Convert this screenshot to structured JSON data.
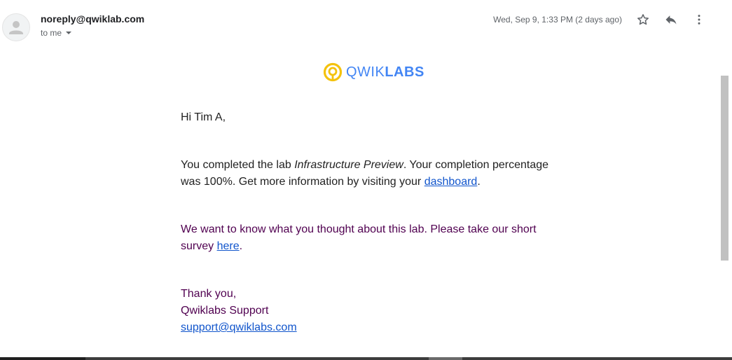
{
  "header": {
    "sender": "noreply@qwiklab.com",
    "to_label": "to me",
    "date": "Wed, Sep 9, 1:33 PM (2 days ago)"
  },
  "icons": {
    "avatar": "person-icon",
    "star": "star-icon",
    "reply": "reply-icon",
    "more": "more-vert-icon",
    "logo": "qwiklabs-logo-icon"
  },
  "logo": {
    "text_light": "QWIK",
    "text_bold": "LABS"
  },
  "body": {
    "greeting": "Hi Tim A,",
    "para1_before": "You completed the lab ",
    "para1_lab": "Infrastructure Preview",
    "para1_after": ". Your completion percentage was 100%. Get more information by visiting your ",
    "para1_link": "dashboard",
    "para1_end": ".",
    "para2_before": "We want to know what you thought about this lab. Please take our short survey ",
    "para2_link": "here",
    "para2_end": ".",
    "sign_thanks": "Thank you,",
    "sign_team": "Qwiklabs Support",
    "sign_email": "support@qwiklabs.com"
  },
  "colors": {
    "link": "#1155cc",
    "quoted_text": "#500050",
    "logo_blue": "#4285f4",
    "logo_yellow": "#f4c20d"
  }
}
